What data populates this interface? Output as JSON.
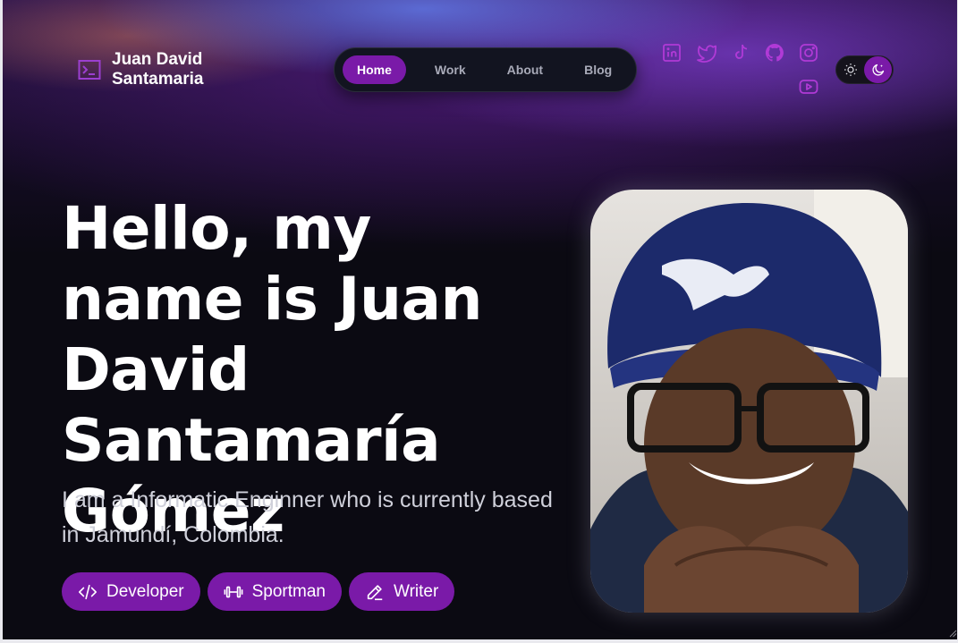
{
  "brand": {
    "name": "Juan David Santamaria",
    "icon": "terminal-icon"
  },
  "nav": {
    "items": [
      {
        "label": "Home",
        "active": true
      },
      {
        "label": "Work",
        "active": false
      },
      {
        "label": "About",
        "active": false
      },
      {
        "label": "Blog",
        "active": false
      }
    ]
  },
  "socials": [
    "linkedin-icon",
    "twitter-icon",
    "tiktok-icon",
    "github-icon",
    "instagram-icon",
    "youtube-icon"
  ],
  "theme": {
    "mode": "dark",
    "light_icon": "sun-icon",
    "dark_icon": "moon-icon"
  },
  "hero": {
    "headline": "Hello, my name is Juan David Santamaría Gómez",
    "subtitle": "I am a Informatic Enginner who is currently based in Jamundí, Colombia.",
    "chips": [
      {
        "label": "Developer",
        "icon": "code-icon"
      },
      {
        "label": "Sportman",
        "icon": "dumbbell-icon"
      },
      {
        "label": "Writer",
        "icon": "pencil-icon"
      }
    ]
  },
  "colors": {
    "accent": "#7a1aa8",
    "social": "#b03ad6",
    "background": "#0b0a12"
  }
}
